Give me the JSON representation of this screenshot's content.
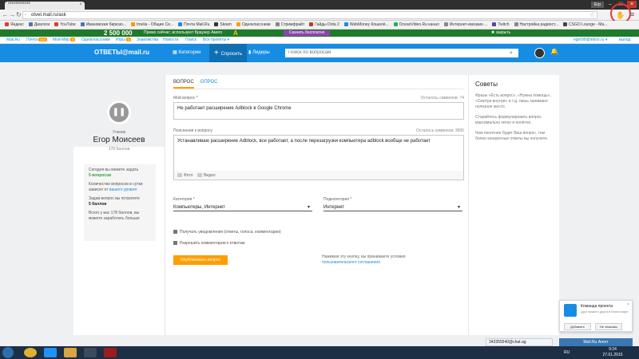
{
  "browser": {
    "tab_title": "************",
    "url": "otvet.mail.ru/ask",
    "window_user": "Егр",
    "bookmarks": [
      {
        "label": "Яндекс",
        "color": "#e53935"
      },
      {
        "label": "Диалоги",
        "color": "#4a76a8"
      },
      {
        "label": "YouTube",
        "color": "#e53935"
      },
      {
        "label": "Ивановская бирюзо...",
        "color": "#4a76a8"
      },
      {
        "label": "Imelia - Общие Се...",
        "color": "#f39c12"
      },
      {
        "label": "Почта Mail.Ru",
        "color": "#168de2"
      },
      {
        "label": "Steam",
        "color": "#333333"
      },
      {
        "label": "Одноклассники",
        "color": "#ff9e00"
      },
      {
        "label": "Стримфрайт",
        "color": "#888888"
      },
      {
        "label": "Гайды Dota 2",
        "color": "#c0392b"
      },
      {
        "label": "WebMoney Кошелё...",
        "color": "#168de2"
      },
      {
        "label": "OceanVideo.Ru канал",
        "color": "#27ae60"
      },
      {
        "label": "Интернет-магазин ...",
        "color": "#888888"
      },
      {
        "label": "Twitch",
        "color": "#6441a5"
      },
      {
        "label": "Настройка радиост...",
        "color": "#888888"
      },
      {
        "label": "CSGO Lounge - Ма...",
        "color": "#444444"
      }
    ]
  },
  "promo": {
    "number": "2 500 000",
    "text": "Премо сейчас: используют Браузер Амиго",
    "logo_letter": "A",
    "download": "Скачать бесплатно",
    "close": "✖ закрыть"
  },
  "portal": {
    "links": [
      "Mail.Ru",
      "Почта",
      "Мой Мир",
      "Одноклассники",
      "Игры",
      "Знакомства",
      "Новости",
      "Поиск",
      "Все проекты ▾"
    ],
    "mail_badge": "143",
    "mir_badge": "9",
    "games_badge": "3",
    "user_email": "egor99@inbox.ru ▾",
    "logout": "выход"
  },
  "header": {
    "logo": "ОТВЕТЫ@mail.ru",
    "nav": [
      "Категории",
      "Спросить",
      "Лидеры"
    ],
    "search_placeholder": "Поиск по вопросам"
  },
  "profile": {
    "rank": "Ученик",
    "name": "Егор Моисеев",
    "points": "178 баллов",
    "stats": [
      {
        "label": "Сегодня вы можете задать",
        "value": "5 вопросов"
      },
      {
        "label": "Количество вопросов в сутки зависит от",
        "link": "вашего уровня"
      },
      {
        "label": "Задав вопрос вы потратите",
        "value": "5 баллов"
      },
      {
        "label": "Всего у вас 178 баллов, вы можете заработать больше"
      }
    ]
  },
  "form": {
    "tabs": [
      "ВОПРОС",
      "ОПРОС"
    ],
    "question_label": "Мой вопрос *",
    "question_remaining": "Осталось символов: 74",
    "question_value": "Не работает расширение Adblock в Google Chrome",
    "details_label": "Пояснения к вопросу",
    "details_remaining": "Осталось символов: 3695",
    "details_value": "Устанавливаю расширение Adblock, все работает, а после перезагрузки компьютера adblock вообще не работает",
    "attach_photo": "Фото",
    "attach_video": "Видео",
    "category_label": "Категория *",
    "category_value": "Компьютеры, Интернет",
    "subcategory_label": "Подкатегория *",
    "subcategory_value": "Интернет",
    "notify_label": "Получать уведомления (ответы, голоса, комментарии)",
    "comments_label": "Разрешить комментарии к ответам",
    "publish": "Опубликовать вопрос",
    "terms_text": "Нажимая эту кнопку, вы принимаете условия",
    "terms_link": "пользовательского соглашения"
  },
  "tips": {
    "title": "Советы",
    "items": [
      "Фразы «Есть вопрос», «Нужна помощь», «Смотри внутри» и т.д. лишь занимают полезное место.",
      "Старайтесь формулировать вопрос максимально четко и понятно.",
      "Чем понятнее будет Ваш вопрос, тем более конкретные ответы вы получите."
    ]
  },
  "friends_popup": {
    "title": "Команда проекта",
    "subtitle": "Друг вашего друга в Моем мире",
    "add": "Добавить",
    "unknown": "Не знакомы"
  },
  "chat": {
    "skype": "343355540@chat.ag",
    "agent": "Mail.Ru Агент"
  },
  "taskbar": {
    "lang": "RU",
    "time": "9:24",
    "date": "27.01.2015"
  }
}
